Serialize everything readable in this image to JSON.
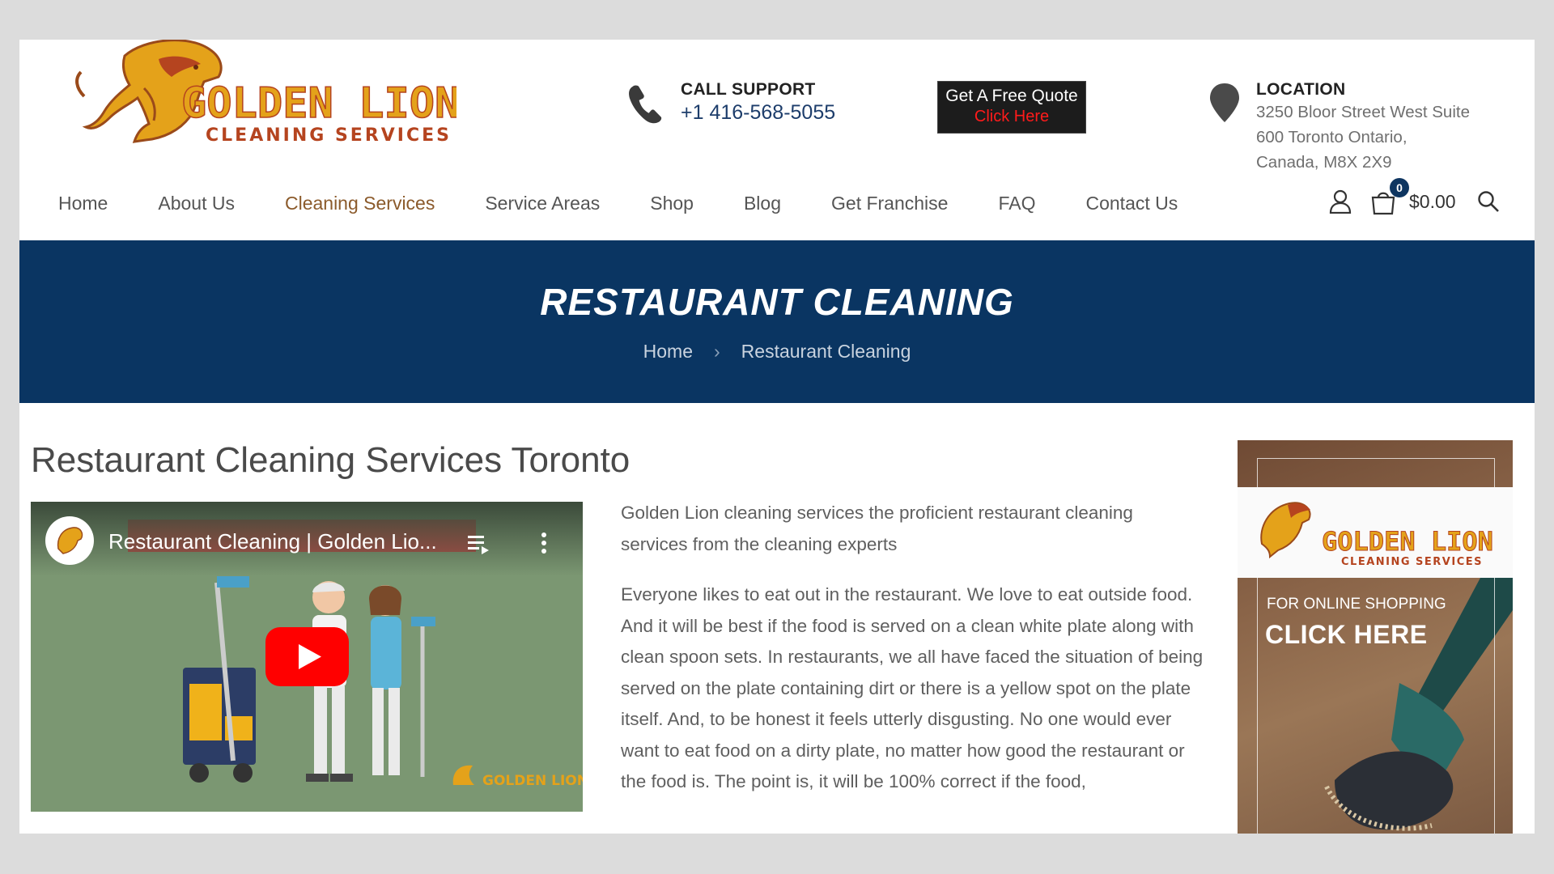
{
  "header": {
    "logo": {
      "line1": "GOLDEN LION",
      "line2": "CLEANING SERVICES"
    },
    "support": {
      "label": "CALL SUPPORT",
      "phone": "+1 416-568-5055"
    },
    "quote": {
      "line1": "Get A Free Quote",
      "line2": "Click Here"
    },
    "location": {
      "label": "LOCATION",
      "address_lines": [
        "3250 Bloor Street West Suite",
        "600 Toronto Ontario,",
        "Canada, M8X 2X9"
      ]
    }
  },
  "nav": {
    "items": [
      {
        "label": "Home"
      },
      {
        "label": "About Us"
      },
      {
        "label": "Cleaning Services",
        "active": true
      },
      {
        "label": "Service Areas"
      },
      {
        "label": "Shop"
      },
      {
        "label": "Blog"
      },
      {
        "label": "Get Franchise"
      },
      {
        "label": "FAQ"
      },
      {
        "label": "Contact Us"
      }
    ],
    "cart_count": "0",
    "cart_total": "$0.00"
  },
  "banner": {
    "title": "RESTAURANT CLEANING",
    "breadcrumb": {
      "home": "Home",
      "separator": "›",
      "current": "Restaurant Cleaning"
    }
  },
  "content": {
    "heading": "Restaurant Cleaning Services Toronto",
    "video": {
      "title": "Restaurant Cleaning | Golden Lio...",
      "watermark": "GOLDEN LION"
    },
    "intro": "Golden Lion cleaning services the proficient restaurant cleaning services from the cleaning experts",
    "paragraph": "Everyone likes to eat out in the restaurant. We love to eat outside food. And it will be best if the food is served on a clean white plate along with clean spoon sets. In restaurants, we all have faced the situation of being served on the plate containing dirt or there is a yellow spot on the plate itself. And, to be honest it feels utterly disgusting. No one would ever want to eat food on a dirty plate, no matter how good the restaurant or the food is. The point is, it will be 100% correct if the food,"
  },
  "sidebar_ad": {
    "logo_line1": "GOLDEN LION",
    "logo_line2": "CLEANING SERVICES",
    "small_text": "FOR ONLINE SHOPPING",
    "big_text": "CLICK HERE"
  },
  "colors": {
    "banner_bg": "#0a3562",
    "nav_active": "#8b5a2b",
    "logo_gold": "#e4a21a",
    "logo_red": "#b5441f",
    "quote_red": "#ff1b1b"
  },
  "icons": [
    "phone-icon",
    "location-pin-icon",
    "user-icon",
    "cart-icon",
    "search-icon",
    "youtube-play-icon",
    "playlist-icon",
    "more-vert-icon"
  ]
}
